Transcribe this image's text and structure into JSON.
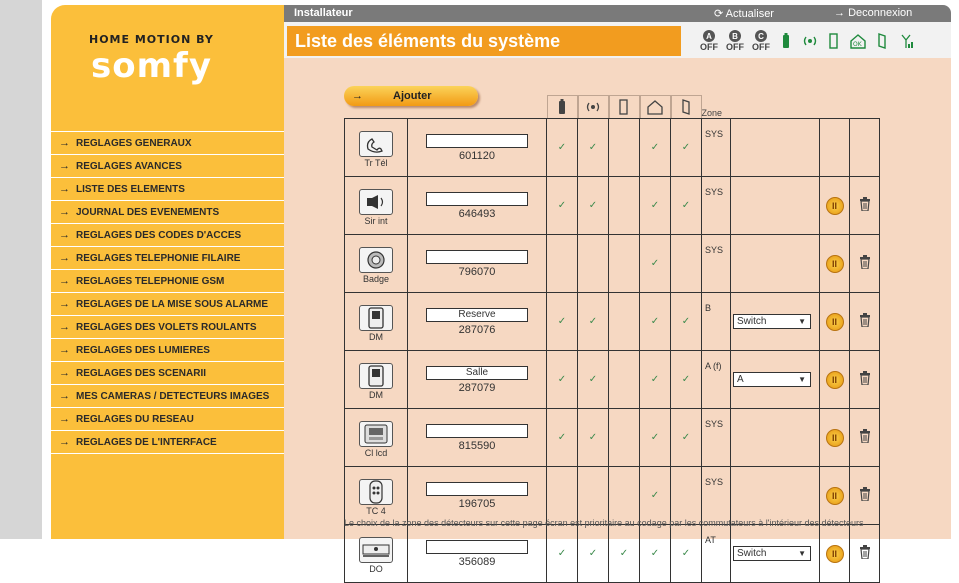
{
  "brand": {
    "line1": "HOME MOTION BY",
    "line2": "somfy"
  },
  "topbar": {
    "title": "Installateur",
    "refresh": "Actualiser",
    "logout": "Deconnexion"
  },
  "header": {
    "title": "Liste des éléments du système"
  },
  "status": {
    "labels": [
      "A",
      "B",
      "C"
    ],
    "off": "OFF"
  },
  "menu": [
    "REGLAGES GENERAUX",
    "REGLAGES AVANCES",
    "LISTE DES ELEMENTS",
    "JOURNAL DES EVENEMENTS",
    "REGLAGES DES CODES D'ACCES",
    "REGLAGES TELEPHONIE FILAIRE",
    "REGLAGES TELEPHONIE GSM",
    "REGLAGES DE LA MISE SOUS ALARME",
    "REGLAGES DES VOLETS ROULANTS",
    "REGLAGES DES LUMIERES",
    "REGLAGES DES SCENARII",
    "MES CAMERAS / DETECTEURS IMAGES",
    "REGLAGES DU RESEAU",
    "REGLAGES DE L'INTERFACE"
  ],
  "add_button": "Ajouter",
  "zone_header": "Zone",
  "rows": [
    {
      "label": "Tr Tél",
      "name": "",
      "serial": "601120",
      "c1": "✓",
      "c2": "✓",
      "c3": "",
      "c4": "✓",
      "c5": "✓",
      "zone": "SYS",
      "select": "",
      "controls": false,
      "icon": "phone-icon"
    },
    {
      "label": "Sir int",
      "name": "",
      "serial": "646493",
      "c1": "✓",
      "c2": "✓",
      "c3": "",
      "c4": "✓",
      "c5": "✓",
      "zone": "SYS",
      "select": "",
      "controls": true,
      "icon": "siren-icon"
    },
    {
      "label": "Badge",
      "name": "",
      "serial": "796070",
      "c1": "",
      "c2": "",
      "c3": "",
      "c4": "✓",
      "c5": "",
      "zone": "SYS",
      "select": "",
      "controls": true,
      "icon": "badge-icon"
    },
    {
      "label": "DM",
      "name": "Reserve",
      "serial": "287076",
      "c1": "✓",
      "c2": "✓",
      "c3": "",
      "c4": "✓",
      "c5": "✓",
      "zone": "B",
      "select": "Switch",
      "controls": true,
      "icon": "motion-detector-icon"
    },
    {
      "label": "DM",
      "name": "Salle",
      "serial": "287079",
      "c1": "✓",
      "c2": "✓",
      "c3": "",
      "c4": "✓",
      "c5": "✓",
      "zone": "A (f)",
      "select": "A",
      "controls": true,
      "icon": "motion-detector-icon"
    },
    {
      "label": "Cl lcd",
      "name": "",
      "serial": "815590",
      "c1": "✓",
      "c2": "✓",
      "c3": "",
      "c4": "✓",
      "c5": "✓",
      "zone": "SYS",
      "select": "",
      "controls": true,
      "icon": "keypad-lcd-icon"
    },
    {
      "label": "TC 4",
      "name": "",
      "serial": "196705",
      "c1": "",
      "c2": "",
      "c3": "",
      "c4": "✓",
      "c5": "",
      "zone": "SYS",
      "select": "",
      "controls": true,
      "icon": "remote-control-icon"
    },
    {
      "label": "DO",
      "name": "",
      "serial": "356089",
      "c1": "✓",
      "c2": "✓",
      "c3": "✓",
      "c4": "✓",
      "c5": "✓",
      "zone": "AT",
      "select": "Switch",
      "controls": true,
      "icon": "opening-detector-icon"
    }
  ],
  "footnote": "Le choix de la zone des détecteurs sur cette page écran est prioritaire au codage par les commutateurs à l'intérieur des détecteurs"
}
